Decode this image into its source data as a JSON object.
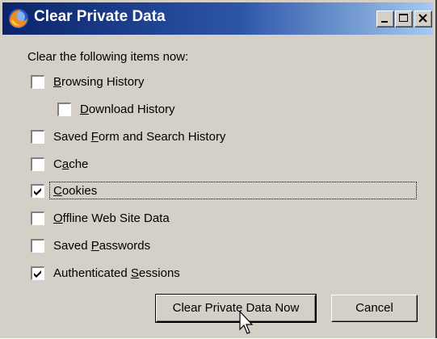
{
  "window": {
    "title": "Clear Private Data",
    "controls": [
      "minimize",
      "maximize",
      "close"
    ]
  },
  "intro": "Clear the following items now:",
  "items": [
    {
      "label": "Browsing History",
      "checked": false,
      "access_key": "B"
    },
    {
      "label": "Download History",
      "checked": false,
      "access_key": "D"
    },
    {
      "label": "Saved Form and Search History",
      "checked": false,
      "access_key": "F"
    },
    {
      "label": "Cache",
      "checked": false,
      "access_key": "a"
    },
    {
      "label": "Cookies",
      "checked": true,
      "access_key": "C",
      "focused": true
    },
    {
      "label": "Offline Web Site Data",
      "checked": false,
      "access_key": "O"
    },
    {
      "label": "Saved Passwords",
      "checked": false,
      "access_key": "P"
    },
    {
      "label": "Authenticated Sessions",
      "checked": true,
      "access_key": "S"
    }
  ],
  "buttons": {
    "primary": "Clear Private Data Now",
    "cancel": "Cancel"
  },
  "icons": {
    "title_icon": "firefox-icon",
    "cursor": "arrow-pointer-icon"
  },
  "colors": {
    "titlebar_start": "#0a246a",
    "titlebar_end": "#a6caf0",
    "dialog_bg": "#d4d0c8"
  }
}
